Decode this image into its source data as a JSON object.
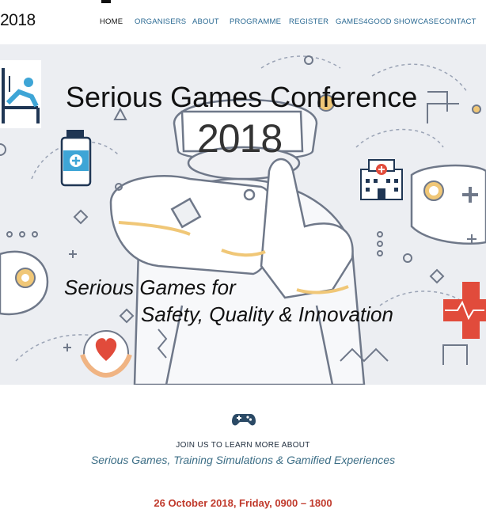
{
  "brand": {
    "text": "2018"
  },
  "nav": {
    "items": [
      {
        "label": "HOME",
        "active": true
      },
      {
        "label": "ORGANISERS"
      },
      {
        "label": "ABOUT"
      },
      {
        "label": "PROGRAMME"
      },
      {
        "label": "REGISTER"
      },
      {
        "label": "GAMES4GOOD SHOWCASE"
      },
      {
        "label": "CONTACT"
      }
    ]
  },
  "hero": {
    "title": "Serious Games Conference",
    "year": "2018",
    "tagline_line1": "Serious Games for",
    "tagline_line2": "Safety, Quality & Innovation",
    "icons": [
      "patient-bed-icon",
      "medicine-bottle-icon",
      "hospital-icon",
      "game-controller-icon",
      "heart-in-hands-icon",
      "heartbeat-cross-icon",
      "vr-headset-icon"
    ]
  },
  "intro": {
    "icon": "gamepad-icon",
    "heading": "JOIN US TO LEARN MORE ABOUT",
    "subheading": "Serious Games, Training Simulations & Gamified Experiences",
    "date_line": "26 October 2018, Friday, 0900 – 1800"
  },
  "colors": {
    "nav_link": "#2b6a93",
    "accent_red": "#c0392b",
    "subheading": "#3c6e86",
    "hero_bg": "#eceef2"
  }
}
